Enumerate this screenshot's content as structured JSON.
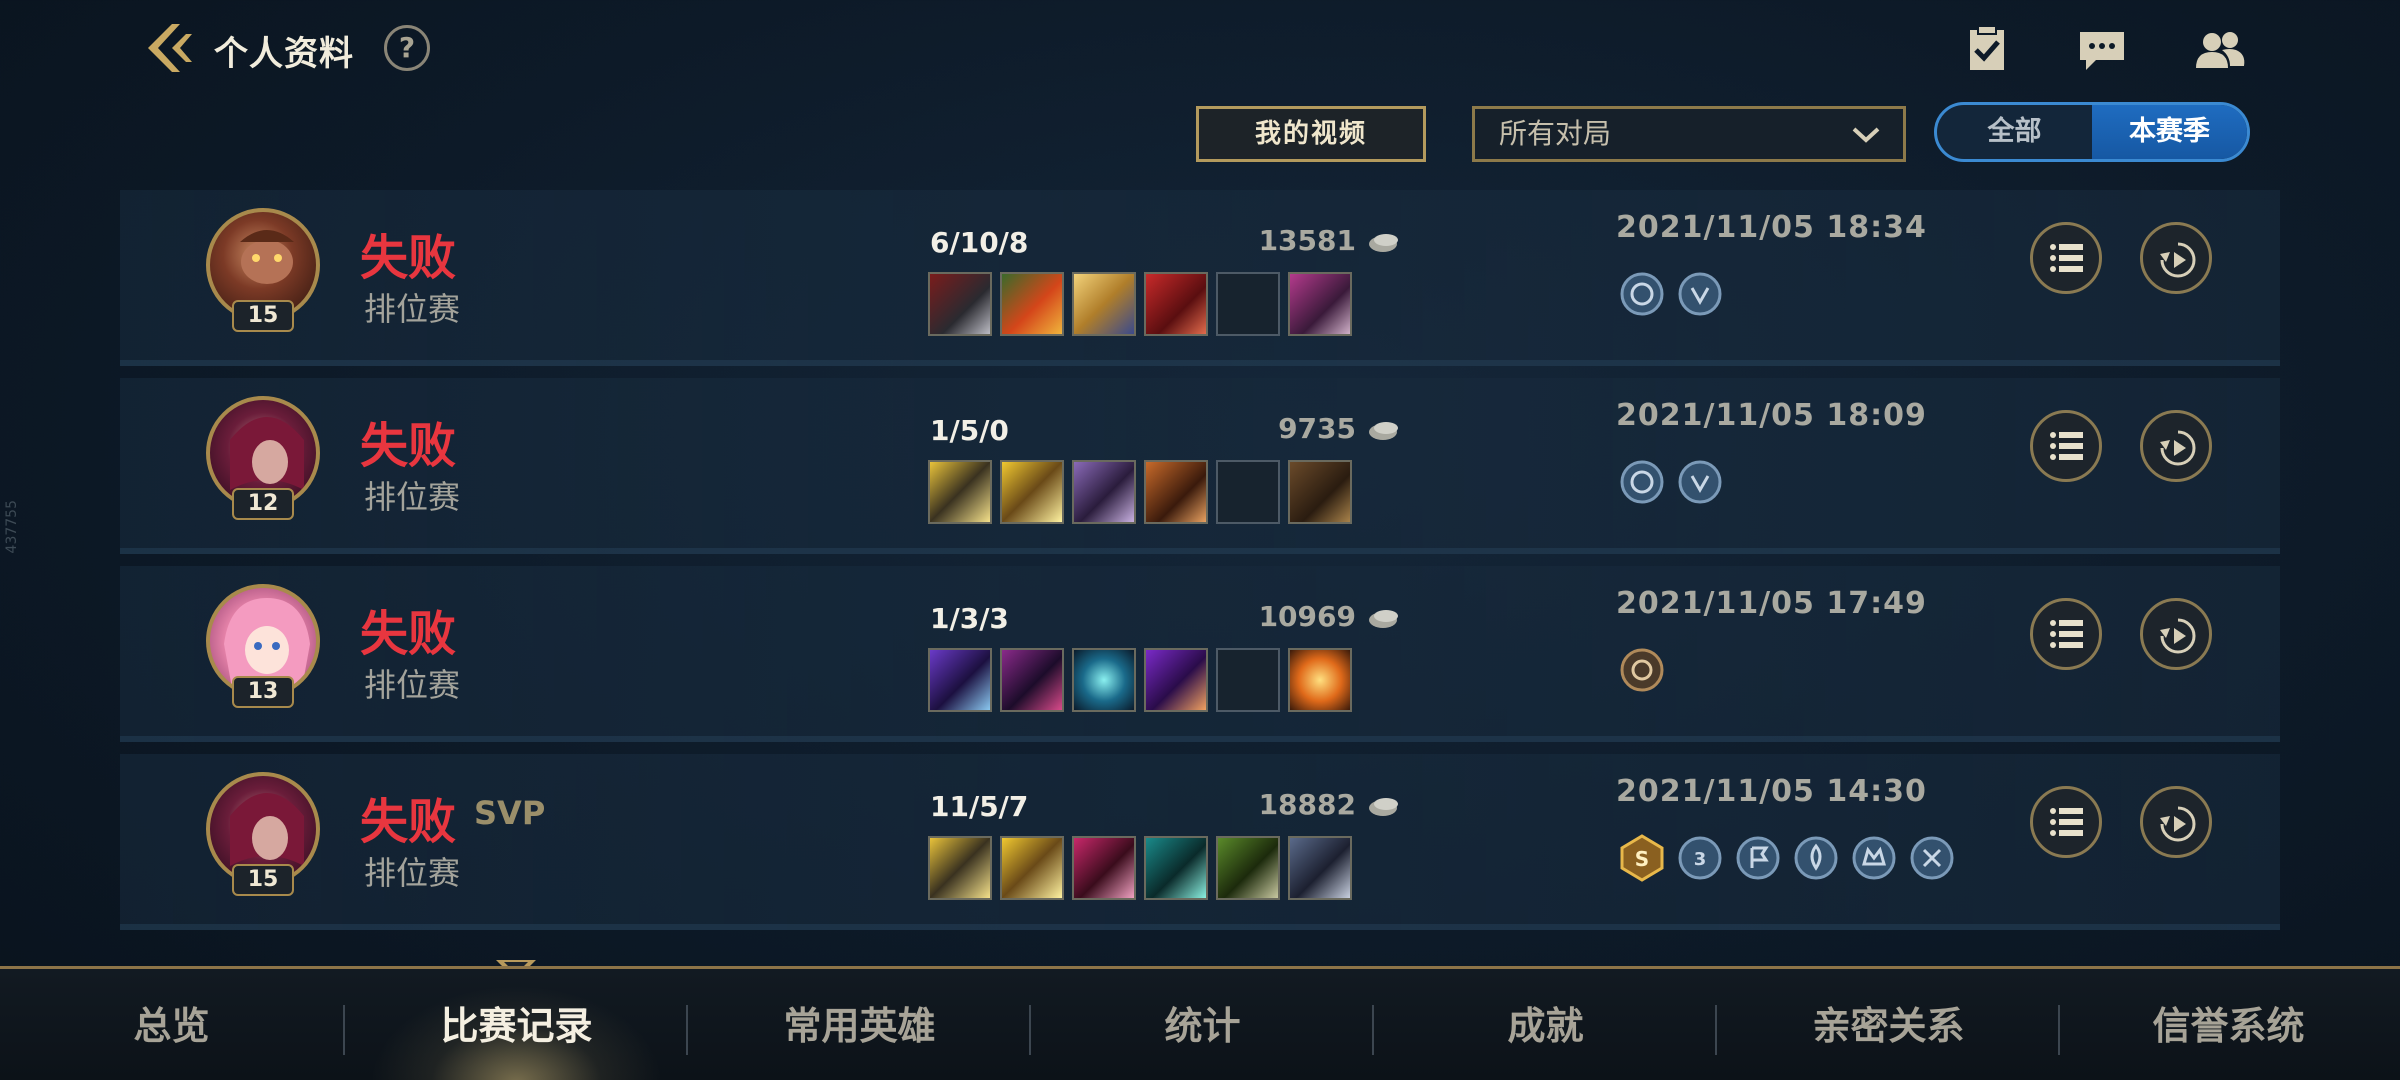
{
  "header": {
    "title": "个人资料",
    "help": "?",
    "icons": [
      "checklist-icon",
      "chat-icon",
      "friends-icon"
    ]
  },
  "filters": {
    "my_videos": "我的视频",
    "match_type": "所有对局",
    "season_toggle": [
      "全部",
      "本赛季"
    ],
    "season_active": "本赛季"
  },
  "matches": [
    {
      "result": "失败",
      "svp": "",
      "mode": "排位赛",
      "level": "15",
      "kda": "6/10/8",
      "gold": "13581",
      "date": "2021/11/05 18:34",
      "champion": "champion-wukong",
      "badge_count": 2
    },
    {
      "result": "失败",
      "svp": "",
      "mode": "排位赛",
      "level": "12",
      "kda": "1/5/0",
      "gold": "9735",
      "date": "2021/11/05 18:09",
      "champion": "champion-xayah",
      "badge_count": 2
    },
    {
      "result": "失败",
      "svp": "",
      "mode": "排位赛",
      "level": "13",
      "kda": "1/3/3",
      "gold": "10969",
      "date": "2021/11/05 17:49",
      "champion": "champion-seraphine",
      "badge_count": 1
    },
    {
      "result": "失败",
      "svp": "SVP",
      "mode": "排位赛",
      "level": "15",
      "kda": "11/5/7",
      "gold": "18882",
      "date": "2021/11/05 14:30",
      "champion": "champion-xayah",
      "badge_count": 6
    }
  ],
  "nav": {
    "items": [
      "总览",
      "比赛记录",
      "常用英雄",
      "统计",
      "成就",
      "亲密关系",
      "信誉系统"
    ],
    "active": "比赛记录"
  },
  "side_note": "437755",
  "colors": {
    "defeat": "#e8363f",
    "accent_gold": "#a88a4c",
    "toggle_active": "#1f6cc0"
  }
}
